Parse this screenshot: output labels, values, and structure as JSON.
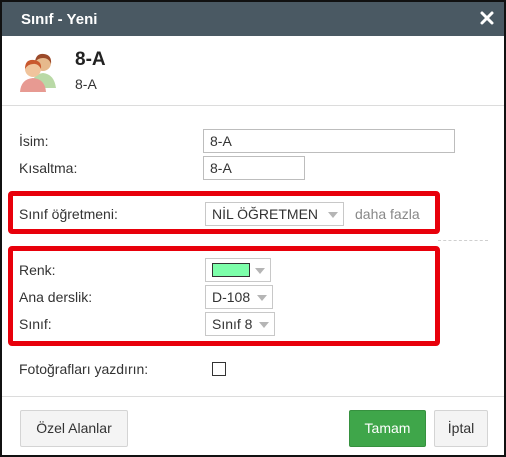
{
  "dialog": {
    "title": "Sınıf - Yeni",
    "close_symbol": "✖"
  },
  "header": {
    "title": "8-A",
    "subtitle": "8-A",
    "icon": "people-icon"
  },
  "form": {
    "name_label": "İsim:",
    "name_value": "8-A",
    "short_label": "Kısaltma:",
    "short_value": "8-A",
    "teacher_label": "Sınıf öğretmeni:",
    "teacher_value": "NİL ÖĞRETMEN",
    "more_link": "daha fazla",
    "color_label": "Renk:",
    "color_value": "#7dffaa",
    "room_label": "Ana derslik:",
    "room_value": "D-108",
    "grade_label": "Sınıf:",
    "grade_value": "Sınıf 8",
    "print_photos_label": "Fotoğrafları yazdırın:",
    "print_photos_checked": false
  },
  "footer": {
    "custom_fields_label": "Özel Alanlar",
    "ok_label": "Tamam",
    "cancel_label": "İptal"
  },
  "colors": {
    "titlebar": "#4a5963",
    "highlight_border": "#e8000b",
    "primary_button": "#3fa64a"
  }
}
